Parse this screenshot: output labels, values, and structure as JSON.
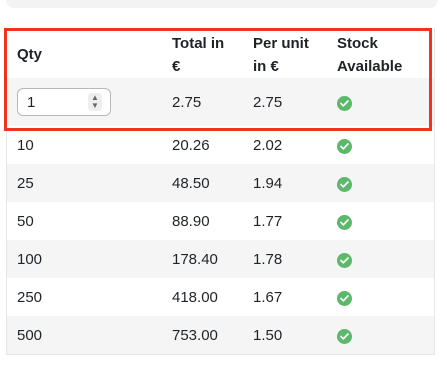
{
  "headers": {
    "qty": "Qty",
    "total_line1": "Total in",
    "total_line2": "€",
    "per_unit_line1": "Per unit",
    "per_unit_line2": "in €",
    "stock_line1": "Stock",
    "stock_line2": "Available"
  },
  "quantity_input": {
    "value": "1",
    "icon": "spinner-up-down-icon"
  },
  "rows": [
    {
      "qty": "10",
      "total": "20.26",
      "unit": "2.02"
    },
    {
      "qty": "25",
      "total": "48.50",
      "unit": "1.94"
    },
    {
      "qty": "50",
      "total": "88.90",
      "unit": "1.77"
    },
    {
      "qty": "100",
      "total": "178.40",
      "unit": "1.78"
    },
    {
      "qty": "250",
      "total": "418.00",
      "unit": "1.67"
    },
    {
      "qty": "500",
      "total": "753.00",
      "unit": "1.50"
    }
  ],
  "first_row": {
    "total": "2.75",
    "unit": "2.75"
  },
  "colors": {
    "check": "#5cb86a",
    "highlight": "#f0321e",
    "alt_row": "#f5f5f5"
  }
}
